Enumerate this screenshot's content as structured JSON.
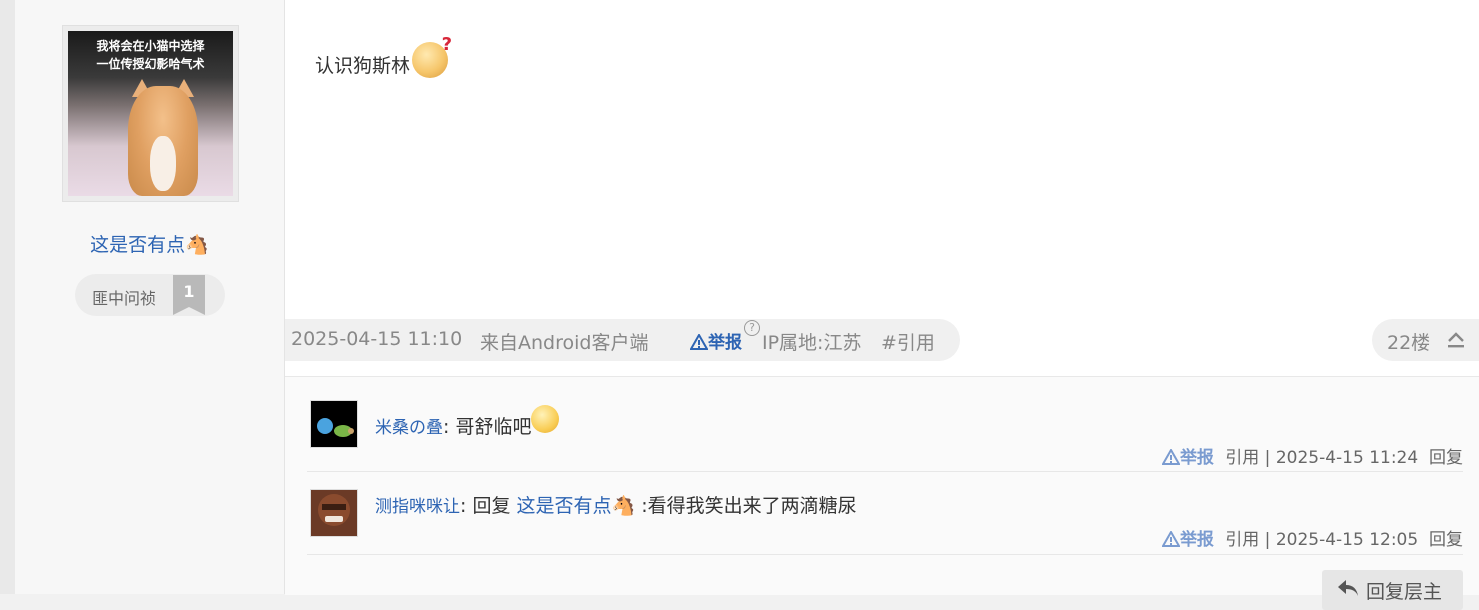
{
  "user": {
    "avatar_caption_line1": "我将会在小猫中选择",
    "avatar_caption_line2": "一位传授幻影哈气术",
    "name": "这是否有点🐴",
    "rank_title": "匪中问祯",
    "rank_level": "1"
  },
  "post": {
    "text": "认识狗斯林",
    "emoji": "confused-face-emoji",
    "date": "2025-04-15 11:10",
    "source": "来自Android客户端",
    "report_label": "举报",
    "help_mark": "?",
    "ip_location": "IP属地:江苏",
    "quote_label": "#引用",
    "floor": "22楼"
  },
  "comments": [
    {
      "author": "米桑の叠",
      "separator": ":",
      "text": "哥舒临吧",
      "emoji": "smile-emoji",
      "report_label": "举报",
      "quote_label": "引用",
      "sep": "|",
      "time": "2025-4-15 11:24",
      "reply_label": "回复"
    },
    {
      "author": "测指咪咪让",
      "separator": ":",
      "reply_prefix": "回复",
      "reply_target": "这是否有点🐴",
      "text": ":看得我笑出来了两滴糖尿",
      "report_label": "举报",
      "quote_label": "引用",
      "sep": "|",
      "time": "2025-4-15 12:05",
      "reply_label": "回复"
    }
  ],
  "reply_host_label": "回复层主",
  "colors": {
    "link": "#2d64b3",
    "meta": "#888888",
    "report_soft": "#7a9bd0"
  }
}
